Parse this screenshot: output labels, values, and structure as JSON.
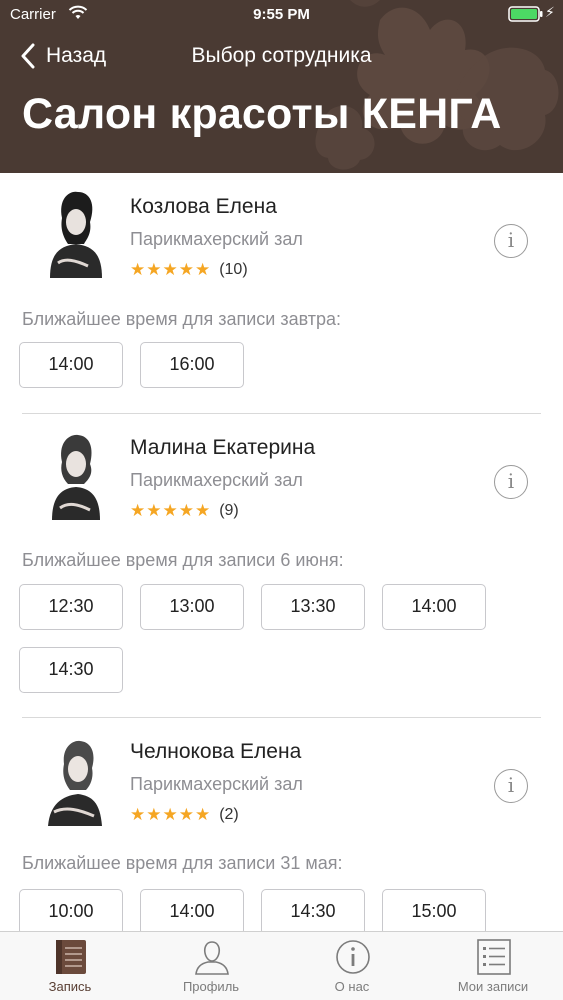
{
  "status_bar": {
    "carrier": "Carrier",
    "time": "9:55 PM"
  },
  "nav": {
    "back_label": "Назад",
    "title": "Выбор сотрудника"
  },
  "page_title": "Салон красоты КЕНГА",
  "colors": {
    "header_bg": "#4a3a33",
    "star": "#f5a623",
    "active_tab": "#5a4035",
    "battery": "#4cd964"
  },
  "employees": [
    {
      "name": "Козлова Елена",
      "department": "Парикмахерский зал",
      "stars": "★★★★★",
      "reviews": "(10)",
      "slots_label": "Ближайшее время для записи завтра:",
      "slots": [
        "14:00",
        "16:00"
      ]
    },
    {
      "name": "Малина Екатерина",
      "department": "Парикмахерский зал",
      "stars": "★★★★★",
      "reviews": "(9)",
      "slots_label": "Ближайшее время для записи 6 июня:",
      "slots": [
        "12:30",
        "13:00",
        "13:30",
        "14:00",
        "14:30"
      ]
    },
    {
      "name": "Челнокова Елена",
      "department": "Парикмахерский зал",
      "stars": "★★★★★",
      "reviews": "(2)",
      "slots_label": "Ближайшее время для записи 31 мая:",
      "slots": [
        "10:00",
        "14:00",
        "14:30",
        "15:00"
      ]
    }
  ],
  "tabbar": {
    "items": [
      {
        "label": "Запись",
        "icon": "book-icon",
        "active": true
      },
      {
        "label": "Профиль",
        "icon": "person-icon",
        "active": false
      },
      {
        "label": "О нас",
        "icon": "info-icon",
        "active": false
      },
      {
        "label": "Мои записи",
        "icon": "list-icon",
        "active": false
      }
    ]
  }
}
